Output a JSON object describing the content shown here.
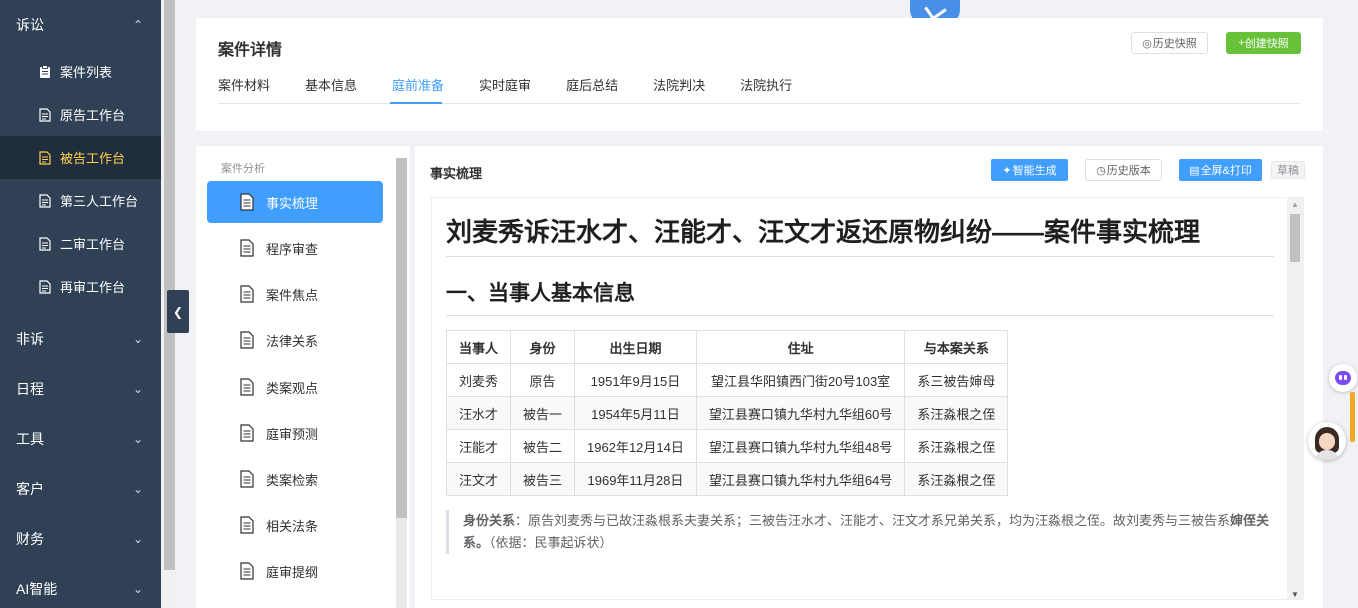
{
  "sidebar": {
    "groups": [
      {
        "label": "诉讼",
        "expanded": true
      },
      {
        "label": "非诉"
      },
      {
        "label": "日程"
      },
      {
        "label": "工具"
      },
      {
        "label": "客户"
      },
      {
        "label": "财务"
      },
      {
        "label": "AI智能"
      }
    ],
    "litigation_items": [
      {
        "label": "案件列表",
        "icon": "clipboard-icon"
      },
      {
        "label": "原告工作台",
        "icon": "document-icon"
      },
      {
        "label": "被告工作台",
        "icon": "document-icon",
        "active": true
      },
      {
        "label": "第三人工作台",
        "icon": "document-icon"
      },
      {
        "label": "二审工作台",
        "icon": "document-icon"
      },
      {
        "label": "再审工作台",
        "icon": "document-icon"
      }
    ],
    "collapse_icon": "chevron-left-icon"
  },
  "header": {
    "title": "案件详情",
    "history_snapshot": "历史快照",
    "create_snapshot": "创建快照",
    "tabs": [
      "案件材料",
      "基本信息",
      "庭前准备",
      "实时庭审",
      "庭后总结",
      "法院判决",
      "法院执行"
    ],
    "active_tab": "庭前准备"
  },
  "analysis": {
    "heading": "案件分析",
    "items": [
      "事实梳理",
      "程序审查",
      "案件焦点",
      "法律关系",
      "类案观点",
      "庭审预测",
      "类案检索",
      "相关法条",
      "庭审提纲"
    ],
    "active": "事实梳理"
  },
  "main": {
    "section_title": "事实梳理",
    "smart_generate": "智能生成",
    "history_version": "历史版本",
    "fullscreen_print": "全屏&打印",
    "draft": "草稿",
    "doc": {
      "h1": "刘麦秀诉汪水才、汪能才、汪文才返还原物纠纷——案件事实梳理",
      "h2": "一、当事人基本信息",
      "table_headers": [
        "当事人",
        "身份",
        "出生日期",
        "住址",
        "与本案关系"
      ],
      "table_rows": [
        [
          "刘麦秀",
          "原告",
          "1951年9月15日",
          "望江县华阳镇西门街20号103室",
          "系三被告婶母"
        ],
        [
          "汪水才",
          "被告一",
          "1954年5月11日",
          "望江县赛口镇九华村九华组60号",
          "系汪淼根之侄"
        ],
        [
          "汪能才",
          "被告二",
          "1962年12月14日",
          "望江县赛口镇九华村九华组48号",
          "系汪淼根之侄"
        ],
        [
          "汪文才",
          "被告三",
          "1969年11月28日",
          "望江县赛口镇九华村九华组64号",
          "系汪淼根之侄"
        ]
      ],
      "note_label": "身份关系",
      "note_text_1": "：原告刘麦秀与已故汪淼根系夫妻关系；三被告汪水才、汪能才、汪文才系兄弟关系，均为汪淼根之侄。故刘麦秀与三被告系",
      "note_bold": "婶侄关系。",
      "note_basis": "（依据：民事起诉状）"
    }
  },
  "colors": {
    "sidebar_bg": "#304156",
    "sidebar_active_text": "#ffd04b",
    "primary": "#409eff",
    "success": "#67c23a"
  }
}
